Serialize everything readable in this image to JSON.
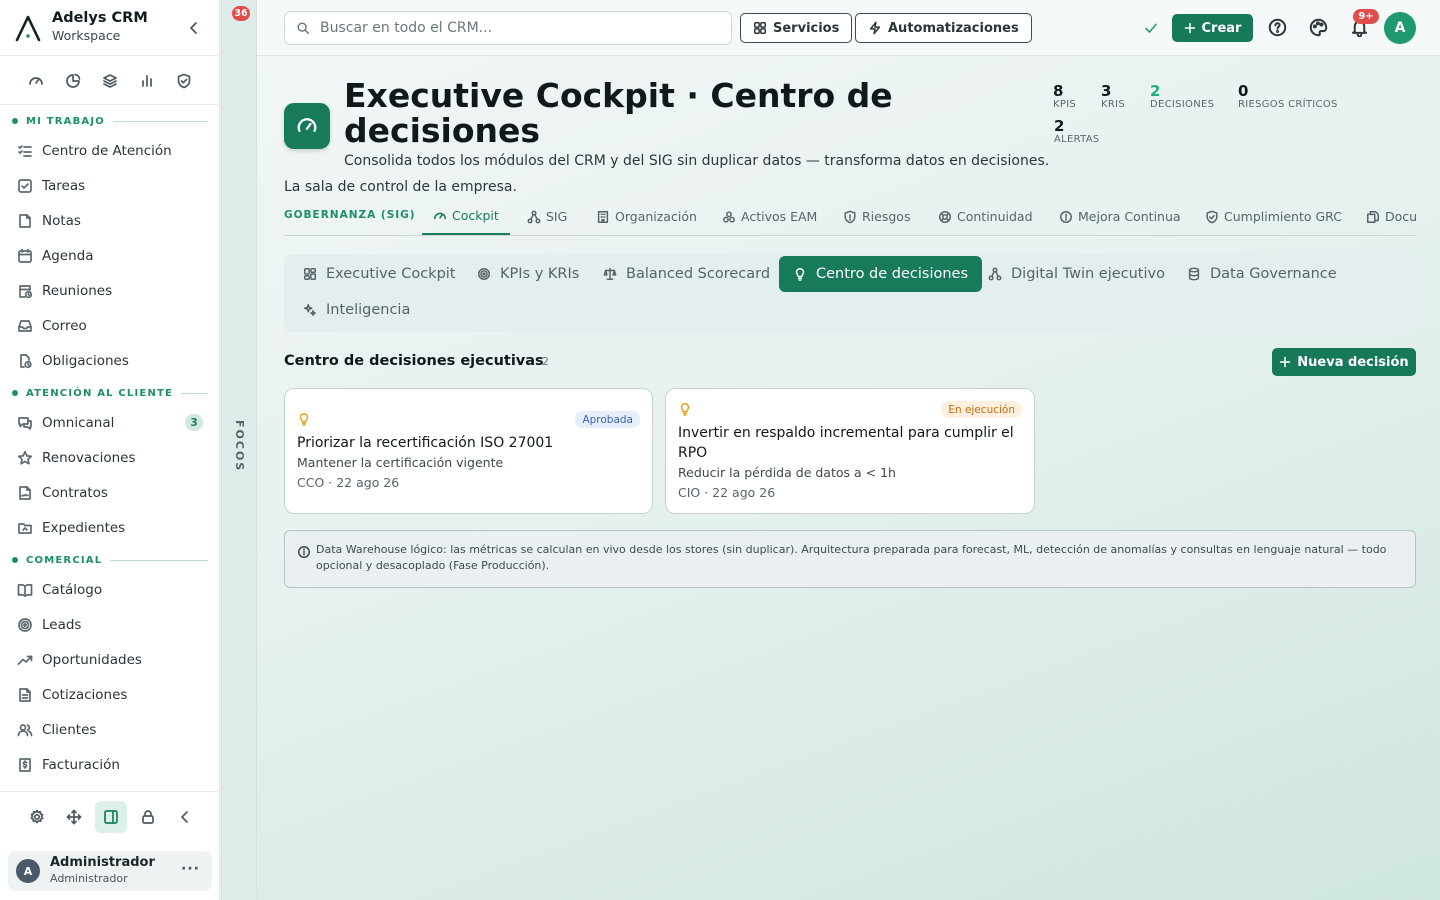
{
  "app": {
    "name": "Adelys CRM",
    "workspace": "Workspace"
  },
  "sidebar": {
    "sections": [
      {
        "label": "MI TRABAJO",
        "items": [
          {
            "label": "Centro de Atención",
            "icon": "list-check-icon"
          },
          {
            "label": "Tareas",
            "icon": "checkbox-icon"
          },
          {
            "label": "Notas",
            "icon": "note-icon"
          },
          {
            "label": "Agenda",
            "icon": "calendar-icon"
          },
          {
            "label": "Reuniones",
            "icon": "calendar-clock-icon"
          },
          {
            "label": "Correo",
            "icon": "inbox-icon"
          },
          {
            "label": "Obligaciones",
            "icon": "file-clock-icon"
          }
        ]
      },
      {
        "label": "ATENCIÓN AL CLIENTE",
        "items": [
          {
            "label": "Omnicanal",
            "icon": "chat-icon",
            "badge": "3"
          },
          {
            "label": "Renovaciones",
            "icon": "star-icon"
          },
          {
            "label": "Contratos",
            "icon": "file-signature-icon"
          },
          {
            "label": "Expedientes",
            "icon": "folder-icon"
          }
        ]
      },
      {
        "label": "COMERCIAL",
        "items": [
          {
            "label": "Catálogo",
            "icon": "book-icon"
          },
          {
            "label": "Leads",
            "icon": "target-icon"
          },
          {
            "label": "Oportunidades",
            "icon": "trend-icon"
          },
          {
            "label": "Cotizaciones",
            "icon": "document-icon"
          },
          {
            "label": "Clientes",
            "icon": "users-icon"
          },
          {
            "label": "Facturación",
            "icon": "invoice-icon"
          }
        ]
      }
    ],
    "user": {
      "initial": "A",
      "name": "Administrador",
      "role": "Administrador"
    }
  },
  "focos": {
    "label": "FOCOS",
    "badge": "36"
  },
  "topbar": {
    "search_placeholder": "Buscar en todo el CRM...",
    "services_label": "Servicios",
    "automations_label": "Automatizaciones",
    "create_label": "Crear",
    "notifications_badge": "9+",
    "avatar_initial": "A"
  },
  "page": {
    "title": "Executive Cockpit · Centro de decisiones",
    "subtitle": "Consolida todos los módulos del CRM y del SIG sin duplicar datos — transforma datos en decisiones.",
    "subtitle2": "La sala de control de la empresa.",
    "stats": [
      {
        "value": "8",
        "label": "KPIS",
        "accent": false
      },
      {
        "value": "3",
        "label": "KRIS",
        "accent": false
      },
      {
        "value": "2",
        "label": "DECISIONES",
        "accent": true
      },
      {
        "value": "0",
        "label": "RIESGOS CRÍTICOS",
        "accent": false
      },
      {
        "value": "2",
        "label": "ALERTAS",
        "accent": false
      }
    ]
  },
  "module_tabs": {
    "group_label": "GOBERNANZA (SIG)",
    "tabs": [
      {
        "label": "Cockpit",
        "icon": "gauge-icon",
        "active": true
      },
      {
        "label": "SIG",
        "icon": "network-icon"
      },
      {
        "label": "Organización",
        "icon": "building-icon"
      },
      {
        "label": "Activos EAM",
        "icon": "assets-icon"
      },
      {
        "label": "Riesgos",
        "icon": "shield-icon"
      },
      {
        "label": "Continuidad",
        "icon": "lifebuoy-icon"
      },
      {
        "label": "Mejora Continua",
        "icon": "alert-circle-icon"
      },
      {
        "label": "Cumplimiento GRC",
        "icon": "shield-check-icon"
      },
      {
        "label": "Docu",
        "icon": "files-icon"
      }
    ]
  },
  "sub_tabs": [
    {
      "label": "Executive Cockpit",
      "icon": "dashboard-icon"
    },
    {
      "label": "KPIs y KRIs",
      "icon": "target-icon"
    },
    {
      "label": "Balanced Scorecard",
      "icon": "scale-icon"
    },
    {
      "label": "Centro de decisiones",
      "icon": "bulb-icon",
      "active": true
    },
    {
      "label": "Digital Twin ejecutivo",
      "icon": "network-icon"
    },
    {
      "label": "Data Governance",
      "icon": "database-icon"
    },
    {
      "label": "Inteligencia",
      "icon": "sparkles-icon"
    }
  ],
  "decisions": {
    "title": "Centro de decisiones ejecutivas",
    "count": "2",
    "new_label": "Nueva decisión",
    "cards": [
      {
        "status": "Aprobada",
        "title": "Priorizar la recertificación ISO 27001",
        "description": "Mantener la certificación vigente",
        "meta": "CCO · 22 ago 26"
      },
      {
        "status": "En ejecución",
        "title": "Invertir en respaldo incremental para cumplir el RPO",
        "description": "Reducir la pérdida de datos a < 1h",
        "meta": "CIO · 22 ago 26"
      }
    ]
  },
  "info_note": "Data Warehouse lógico: las métricas se calculan en vivo desde los stores (sin duplicar). Arquitectura preparada para forecast, ML, detección de anomalías y consultas en lenguaje natural — todo opcional y desacoplado (Fase Producción).",
  "colors": {
    "brand": "#16795a",
    "accent": "#1fae7a",
    "badge_red": "#e24c4b"
  }
}
